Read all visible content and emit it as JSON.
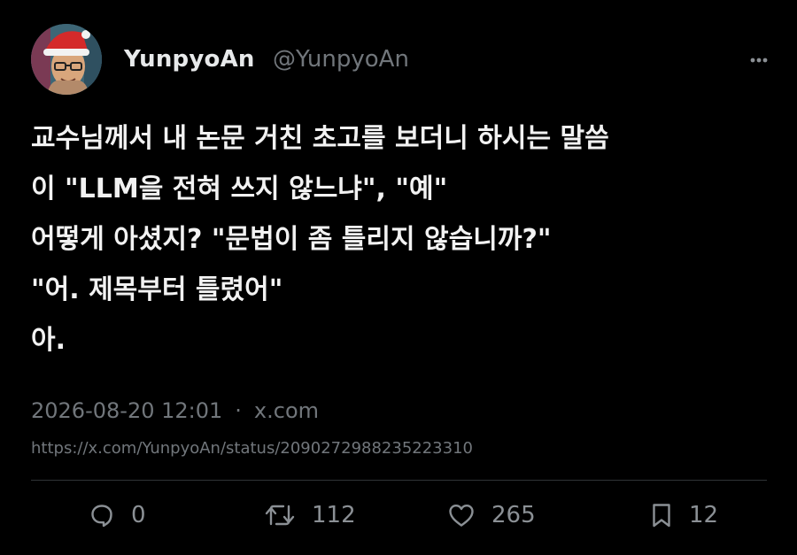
{
  "author": {
    "display_name": "YunpyoAn",
    "handle": "@YunpyoAn"
  },
  "tweet": {
    "text": "교수님께서 내 논문 거친 초고를 보더니 하시는 말씀\n이 \"LLM을 전혀 쓰지 않느냐\", \"예\"\n어떻게 아셨지? \"문법이 좀 틀리지 않습니까?\"\n\"어. 제목부터 틀렸어\"\n아.",
    "timestamp": "2026-08-20 12:01",
    "separator": "·",
    "source": "x.com",
    "url": "https://x.com/YunpyoAn/status/2090272988235223310"
  },
  "actions": {
    "replies": "0",
    "retweets": "112",
    "likes": "265",
    "bookmarks": "12"
  },
  "icons": {
    "more": "more-horizontal-icon",
    "reply": "reply-bubble-icon",
    "retweet": "retweet-icon",
    "like": "heart-icon",
    "bookmark": "bookmark-icon"
  },
  "colors": {
    "background": "#000000",
    "primary_text": "#e7e9ea",
    "secondary_text": "#71767b",
    "divider": "#2f3336"
  }
}
